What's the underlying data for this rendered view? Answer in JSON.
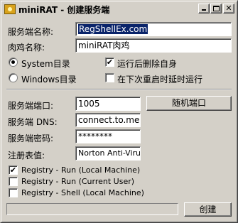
{
  "window": {
    "title": "miniRAT - 创建服务端"
  },
  "form": {
    "server_name_label": "服务端名称:",
    "server_name_value": "RegShellEx.com",
    "bot_name_label": "肉鸡名称:",
    "bot_name_value": "miniRAT肉鸡",
    "radio_system_label": "System目录",
    "radio_windows_label": "Windows目录",
    "check_delete_self_label": "运行后删除自身",
    "check_delay_run_label": "在下次重启时延时运行",
    "port_label": "服务端端口:",
    "port_value": "1005",
    "random_port_button": "随机端口",
    "dns_label": "服务端 DNS:",
    "dns_value": "connect.to.me",
    "password_label": "服务端密码:",
    "password_value": "********",
    "registry_value_label": "注册表值:",
    "registry_value": "Norton Anti-Virus",
    "reg_run_local_label": "Registry - Run (Local Machine)",
    "reg_run_user_label": "Registry - Run (Current User)",
    "reg_shell_local_label": "Registry - Shell (Local Machine)",
    "create_button": "创建"
  },
  "state": {
    "radio_system_selected": true,
    "radio_windows_selected": false,
    "delete_self_checked": true,
    "delay_run_checked": false,
    "reg_run_local_checked": true,
    "reg_run_user_checked": false,
    "reg_shell_local_checked": false,
    "progress": 0
  },
  "icons": {
    "app": "rat-app-icon",
    "minimize": "minimize-icon",
    "maximize": "maximize-icon",
    "close": "close-icon"
  }
}
